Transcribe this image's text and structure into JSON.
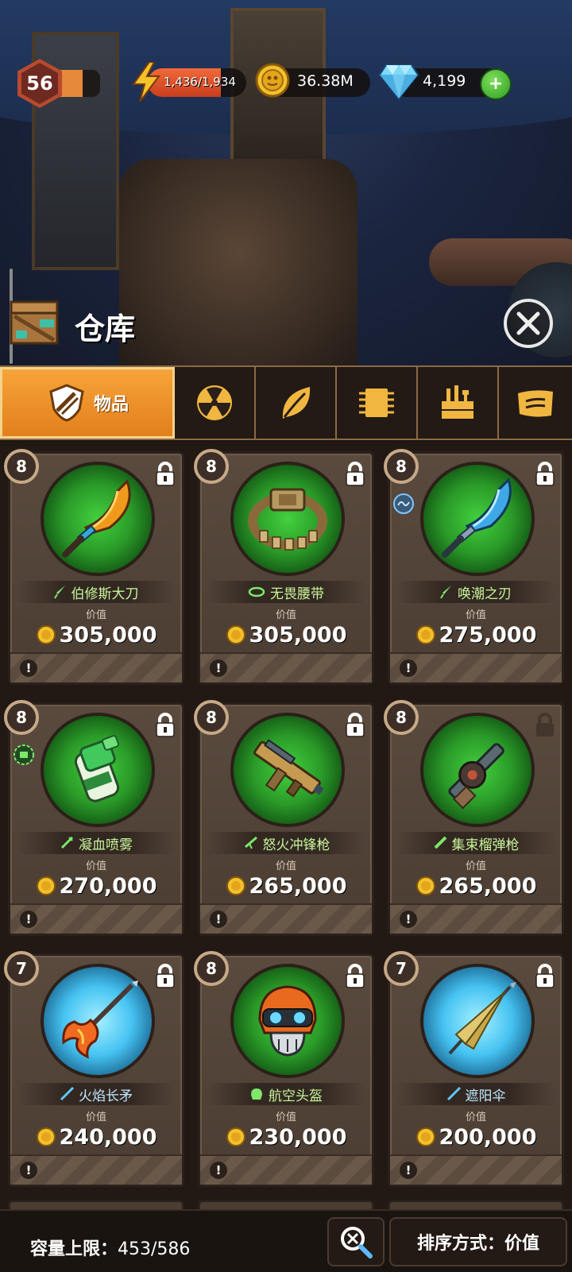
{
  "hud": {
    "level": "56",
    "xp_fraction": 0.6,
    "energy": "1,436/1,934",
    "energy_fraction": 0.74,
    "coins": "36.38M",
    "gems": "4,199",
    "plus_label": "+"
  },
  "header": {
    "title": "仓库",
    "icons": [
      "crate-icon",
      "close-icon"
    ]
  },
  "tabs": [
    {
      "label": "物品",
      "icon": "shield-icon",
      "active": true
    },
    {
      "label": "",
      "icon": "radiation-icon",
      "active": false
    },
    {
      "label": "",
      "icon": "leaf-icon",
      "active": false
    },
    {
      "label": "",
      "icon": "chip-icon",
      "active": false
    },
    {
      "label": "",
      "icon": "toolbox-icon",
      "active": false
    },
    {
      "label": "",
      "icon": "scroll-icon",
      "active": false
    }
  ],
  "items": [
    {
      "tier": "8",
      "name": "伯修斯大刀",
      "value_label": "价值",
      "value": "305,000",
      "orb": "green",
      "icon": "orange-blade-icon",
      "category_icon": "blade-icon",
      "locked": true
    },
    {
      "tier": "8",
      "name": "无畏腰带",
      "value_label": "价值",
      "value": "305,000",
      "orb": "green",
      "icon": "belt-icon",
      "category_icon": "belt-small-icon",
      "locked": true
    },
    {
      "tier": "8",
      "name": "唤潮之刃",
      "value_label": "价值",
      "value": "275,000",
      "orb": "green",
      "icon": "blue-blade-icon",
      "category_icon": "blade-icon",
      "locked": true,
      "side_badge": "wave-badge-icon"
    },
    {
      "tier": "8",
      "name": "凝血喷雾",
      "value_label": "价值",
      "value": "270,000",
      "orb": "green",
      "icon": "spray-icon",
      "category_icon": "syringe-icon",
      "locked": true,
      "side_badge": "heal-badge-icon"
    },
    {
      "tier": "8",
      "name": "怒火冲锋枪",
      "value_label": "价值",
      "value": "265,000",
      "orb": "green",
      "icon": "smg-icon",
      "category_icon": "gun-icon",
      "locked": true
    },
    {
      "tier": "8",
      "name": "集束榴弹枪",
      "value_label": "价值",
      "value": "265,000",
      "orb": "green",
      "icon": "grenade-launcher-icon",
      "category_icon": "launcher-icon",
      "locked": false
    },
    {
      "tier": "7",
      "name": "火焰长矛",
      "value_label": "价值",
      "value": "240,000",
      "orb": "blue",
      "icon": "flame-spear-icon",
      "category_icon": "spear-icon",
      "locked": true
    },
    {
      "tier": "8",
      "name": "航空头盔",
      "value_label": "价值",
      "value": "230,000",
      "orb": "green",
      "icon": "helmet-icon",
      "category_icon": "helmet-small-icon",
      "locked": true
    },
    {
      "tier": "7",
      "name": "遮阳伞",
      "value_label": "价值",
      "value": "200,000",
      "orb": "blue",
      "icon": "umbrella-icon",
      "category_icon": "spear-icon",
      "locked": true
    }
  ],
  "footer": {
    "capacity_label": "容量上限：",
    "capacity_value": "453/586",
    "sort_label": "排序方式：价值"
  },
  "colors": {
    "accent": "#e27f1c",
    "item_name": "#c8f59a",
    "green_orb": "#2a9a28",
    "blue_orb": "#46c3f2"
  }
}
